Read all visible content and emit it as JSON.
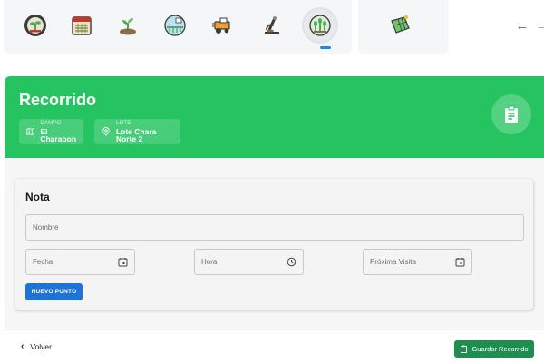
{
  "tabs": [
    {
      "icon": "sprout-badge-icon"
    },
    {
      "icon": "field-calendar-icon"
    },
    {
      "icon": "seedling-icon"
    },
    {
      "icon": "irrigation-globe-icon"
    },
    {
      "icon": "harvester-icon"
    },
    {
      "icon": "microscope-icon"
    },
    {
      "icon": "crop-inspection-icon",
      "active": true
    },
    {
      "icon": "solar-panel-icon"
    }
  ],
  "header": {
    "title": "Recorrido",
    "campo_label": "CAMPO",
    "campo_value": "El Charabon",
    "lote_label": "LOTE",
    "lote_value": "Lote Chara Norte 2",
    "bg_color": "#26c461"
  },
  "card": {
    "title": "Nota",
    "nombre_label": "Nombre",
    "fecha_label": "Fecha",
    "hora_label": "Hora",
    "proxima_label": "Próxima Visita",
    "nuevo_punto_label": "NUEVO PUNTO"
  },
  "footer": {
    "back_label": "Volver",
    "save_label": "Guardar Recorrido",
    "save_color": "#1e8e4e"
  }
}
